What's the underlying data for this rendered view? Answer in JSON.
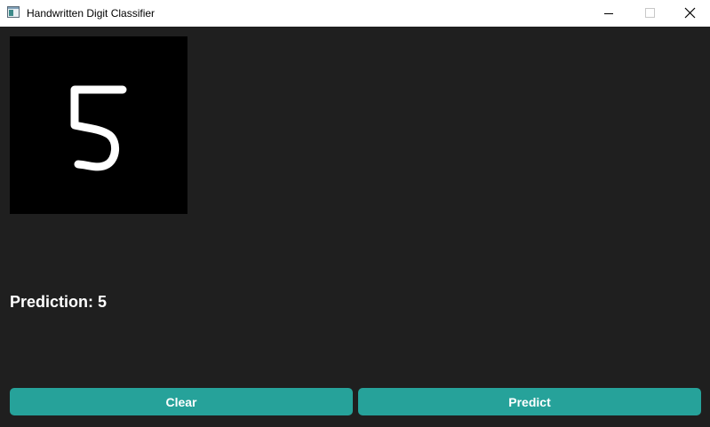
{
  "window": {
    "title": "Handwritten Digit Classifier",
    "icon": "app-window-icon",
    "controls": [
      "minimize-icon",
      "maximize-icon",
      "close-icon"
    ]
  },
  "canvas": {
    "background": "#000000",
    "stroke_color": "#ffffff",
    "drawn_digit": "5"
  },
  "prediction": {
    "text": "Prediction: 5"
  },
  "buttons": {
    "clear_label": "Clear",
    "predict_label": "Predict",
    "color": "#26a29a"
  },
  "theme": {
    "background": "#1f1f1f",
    "titlebar": "#ffffff"
  }
}
